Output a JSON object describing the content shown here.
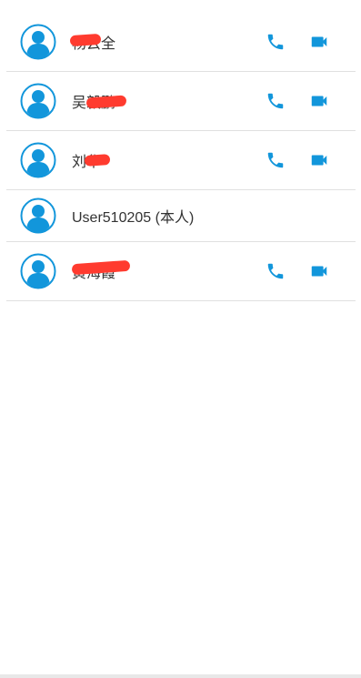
{
  "colors": {
    "accent": "#1296db",
    "redaction": "#ff3b2f",
    "divider": "#e0e0e0",
    "text": "#333333"
  },
  "contacts": [
    {
      "name": "杨云全",
      "self": false,
      "actions": [
        "phone-icon",
        "video-icon"
      ]
    },
    {
      "name": "吴毅鹏",
      "self": false,
      "actions": [
        "phone-icon",
        "video-icon"
      ]
    },
    {
      "name": "刘华",
      "self": false,
      "actions": [
        "phone-icon",
        "video-icon"
      ]
    },
    {
      "name": "User510205 (本人)",
      "self": true,
      "actions": []
    },
    {
      "name": "黄海霞",
      "self": false,
      "actions": [
        "phone-icon",
        "video-icon"
      ]
    }
  ]
}
